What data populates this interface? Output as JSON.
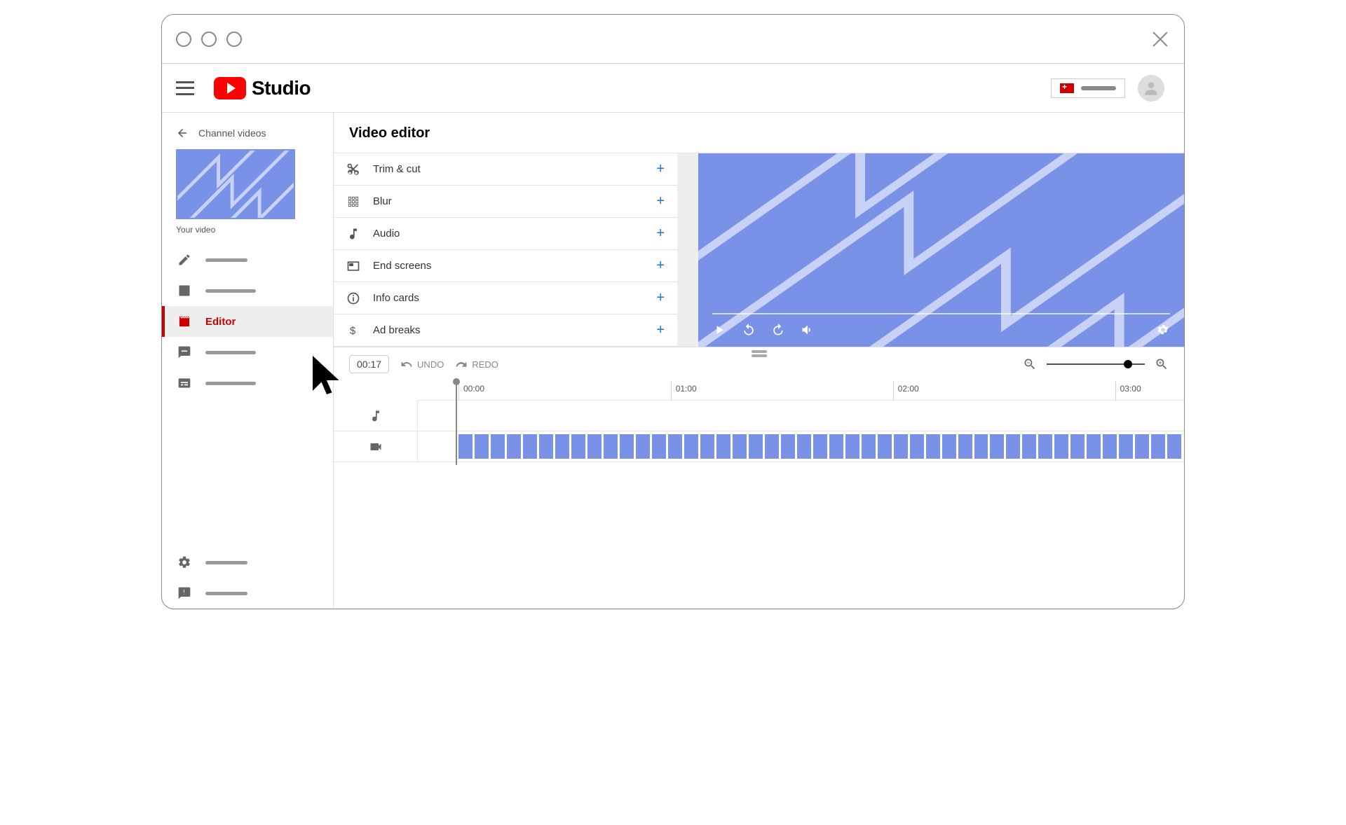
{
  "brand": {
    "name": "Studio"
  },
  "sidebar": {
    "back_label": "Channel videos",
    "your_video_label": "Your video",
    "editor_label": "Editor"
  },
  "page": {
    "title": "Video editor"
  },
  "tools": {
    "trim": "Trim & cut",
    "blur": "Blur",
    "audio": "Audio",
    "endscreens": "End screens",
    "infocards": "Info cards",
    "adbreaks": "Ad breaks"
  },
  "timeline": {
    "current_time": "00:17",
    "undo_label": "UNDO",
    "redo_label": "REDO",
    "ticks": {
      "t0": "00:00",
      "t1": "01:00",
      "t2": "02:00",
      "t3": "03:00"
    },
    "clip_count": 45
  }
}
